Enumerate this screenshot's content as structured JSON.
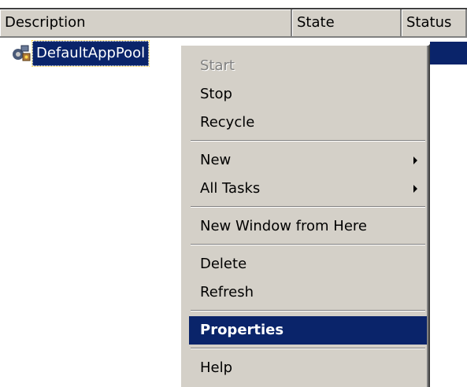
{
  "columns": {
    "description": "Description",
    "state": "State",
    "status": "Status"
  },
  "row": {
    "label": "DefaultAppPool",
    "icon": "app-pool-icon"
  },
  "menu": {
    "start": "Start",
    "stop": "Stop",
    "recycle": "Recycle",
    "new": "New",
    "all_tasks": "All Tasks",
    "new_window": "New Window from Here",
    "delete": "Delete",
    "refresh": "Refresh",
    "properties": "Properties",
    "help": "Help"
  },
  "colors": {
    "selection": "#0a246a",
    "menu_background": "#d4d0c8"
  }
}
